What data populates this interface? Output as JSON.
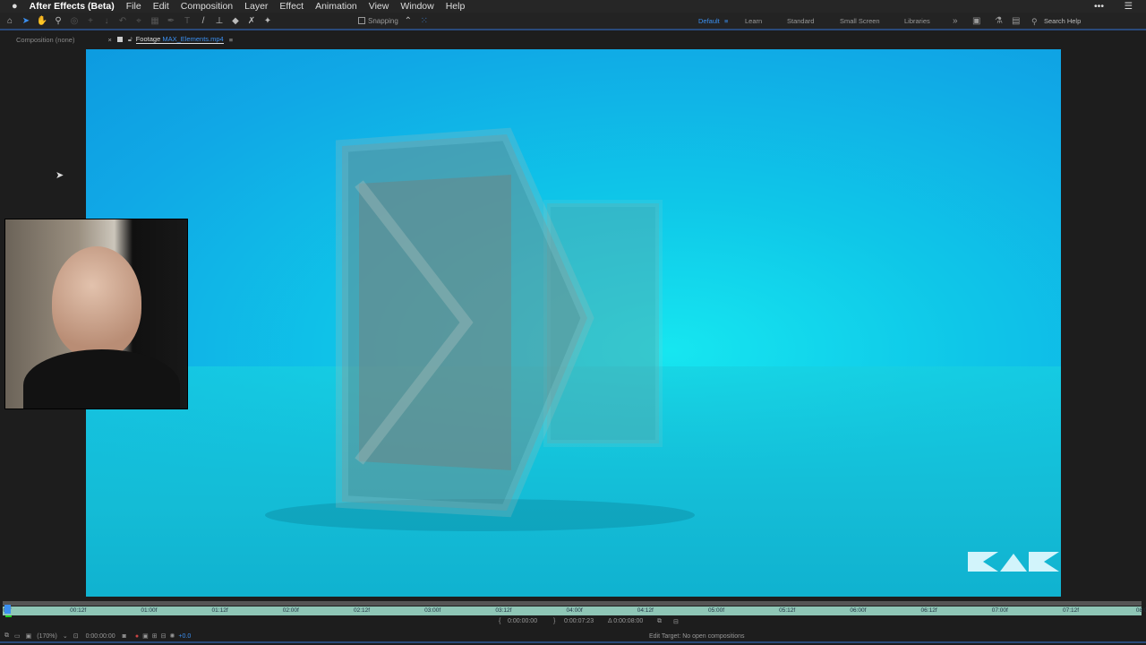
{
  "menubar": {
    "apple": "",
    "app": "After Effects (Beta)",
    "items": [
      "File",
      "Edit",
      "Composition",
      "Layer",
      "Effect",
      "Animation",
      "View",
      "Window",
      "Help"
    ]
  },
  "toolbar": {
    "snapping": "Snapping"
  },
  "workspaces": {
    "default": "Default",
    "learn": "Learn",
    "standard": "Standard",
    "small_screen": "Small Screen",
    "libraries": "Libraries",
    "search_placeholder": "Search Help"
  },
  "tabs": {
    "composition": "Composition (none)",
    "footage_prefix": "Footage",
    "footage_name": "MAX_Elements.mp4"
  },
  "ruler": {
    "ticks": [
      "00f",
      "00:12f",
      "01:00f",
      "01:12f",
      "02:00f",
      "02:12f",
      "03:00f",
      "03:12f",
      "04:00f",
      "04:12f",
      "05:00f",
      "05:12f",
      "06:00f",
      "06:12f",
      "07:00f",
      "07:12f",
      "08:0"
    ]
  },
  "timing": {
    "in": "0:00:00:00",
    "out": "0:00:07:23",
    "duration": "Δ 0:00:08:00"
  },
  "bottom": {
    "zoom": "(170%)",
    "timecode": "0:00:00:00",
    "exposure": "+0.0",
    "edit_target": "Edit Target: No open compositions"
  },
  "colors": {
    "accent": "#2d8ceb",
    "ruler": "#8fc6b6"
  }
}
